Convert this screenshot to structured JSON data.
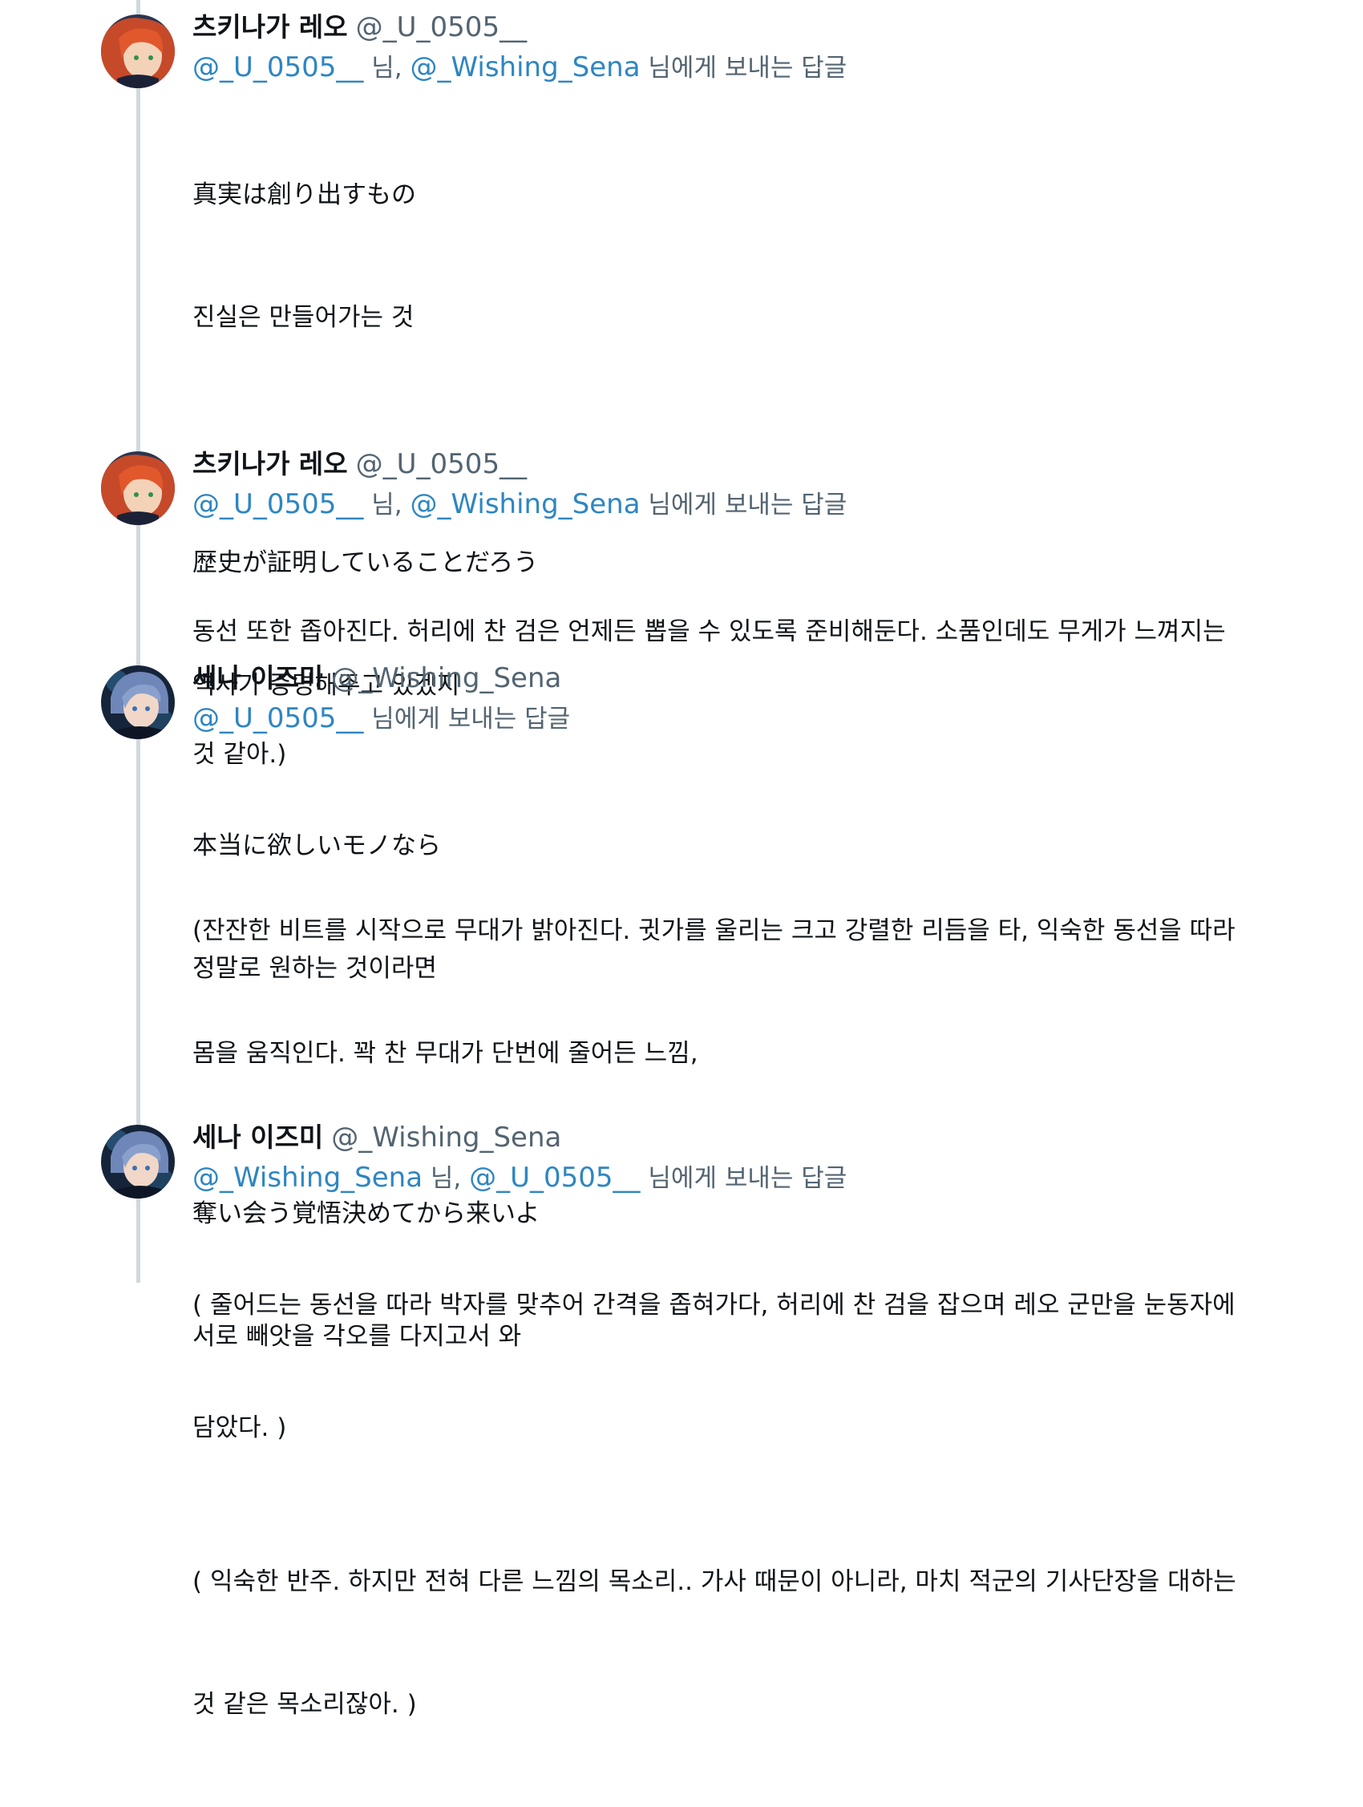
{
  "tweets": [
    {
      "display_name": "츠키나가 레오",
      "handle": "@_U_0505__",
      "reply": {
        "mentions": [
          "@_U_0505__",
          "@_Wishing_Sena"
        ],
        "separator": " 님, ",
        "suffix": " 님에게 보내는 답글"
      },
      "lines": [
        "真実は創り出すもの",
        "진실은 만들어가는 것",
        "",
        "歴史が証明していることだろう",
        "역사가 증명해주고 있겠지",
        "",
        "(잔잔한 비트를 시작으로 무대가 밝아진다. 귓가를 울리는 크고 강렬한 리듬을 타, 익숙한 동선을 따라",
        "몸을 움직인다. 꽉 찬 무대가 단번에 줄어든 느낌,"
      ]
    },
    {
      "display_name": "츠키나가 레오",
      "handle": "@_U_0505__",
      "reply": {
        "mentions": [
          "@_U_0505__",
          "@_Wishing_Sena"
        ],
        "separator": " 님, ",
        "suffix": " 님에게 보내는 답글"
      },
      "lines": [
        "동선 또한 좁아진다. 허리에 찬 검은 언제든 뽑을 수 있도록 준비해둔다. 소품인데도 무게가 느껴지는",
        "것 같아.)"
      ]
    },
    {
      "display_name": "세나 이즈미",
      "handle": "@_Wishing_Sena",
      "reply": {
        "mentions": [
          "@_U_0505__"
        ],
        "separator": "",
        "suffix": " 님에게 보내는 답글"
      },
      "lines": [
        "本当に欲しいモノなら",
        "정말로 원하는 것이라면",
        "",
        "奪い会う覚悟決めてから来いよ",
        "서로 빼앗을 각오를 다지고서 와",
        "",
        "( 익숙한 반주. 하지만 전혀 다른 느낌의 목소리.. 가사 때문이 아니라, 마치 적군의 기사단장을 대하는",
        "것 같은 목소리잖아. )"
      ]
    },
    {
      "display_name": "세나 이즈미",
      "handle": "@_Wishing_Sena",
      "reply": {
        "mentions": [
          "@_Wishing_Sena",
          "@_U_0505__"
        ],
        "separator": " 님, ",
        "suffix": " 님에게 보내는 답글"
      },
      "lines": [
        "( 줄어드는 동선을 따라 박자를 맞추어 간격을 좁혀가다, 허리에 찬 검을 잡으며 레오 군만을 눈동자에",
        "담았다. )"
      ]
    }
  ],
  "colors": {
    "mention": "#2e86c1",
    "secondary_text": "#536471",
    "thread_line": "#cfd9de"
  }
}
